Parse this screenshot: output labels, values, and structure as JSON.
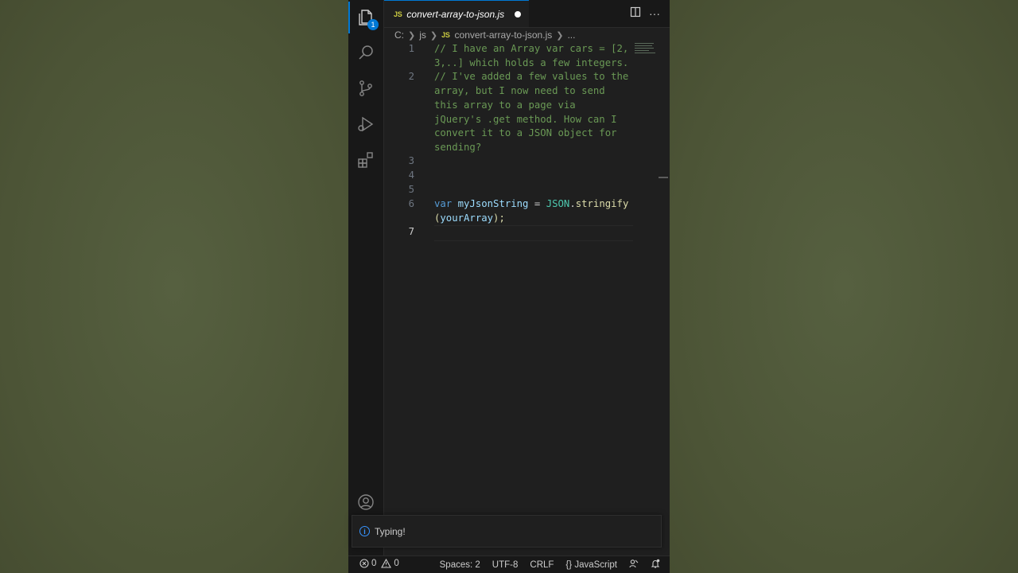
{
  "tab": {
    "lang_badge": "JS",
    "title": "convert-array-to-json.js"
  },
  "activity": {
    "explorer_badge": "1"
  },
  "breadcrumb": {
    "drive": "C:",
    "folder": "js",
    "lang_badge": "JS",
    "file": "convert-array-to-json.js",
    "more": "..."
  },
  "editor": {
    "line_numbers": [
      "1",
      "2",
      "3",
      "4",
      "5",
      "6",
      "7"
    ],
    "current_line": "7",
    "comment_line1a": "// I have an Array var cars = [2,",
    "comment_line1b": "3,..] which holds a few integers.",
    "comment_line2a": "// I've added a few values to the",
    "comment_line2b": "array, but I now need to send",
    "comment_line2c": "this array to a page via",
    "comment_line2d": "jQuery's .get method. How can I",
    "comment_line2e": "convert it to a JSON object for",
    "comment_line2f": "sending?",
    "code_kw": "var",
    "code_var": "myJsonString",
    "code_eq": " = ",
    "code_obj": "JSON",
    "code_dot": ".",
    "code_fn": "stringify",
    "code_open": "(",
    "code_arg": "yourArray",
    "code_close": ");"
  },
  "notification": {
    "message": "Typing!"
  },
  "statusbar": {
    "errors": "0",
    "warnings": "0",
    "spaces": "Spaces: 2",
    "encoding": "UTF-8",
    "eol": "CRLF",
    "language": "JavaScript",
    "language_icon": "{}"
  }
}
